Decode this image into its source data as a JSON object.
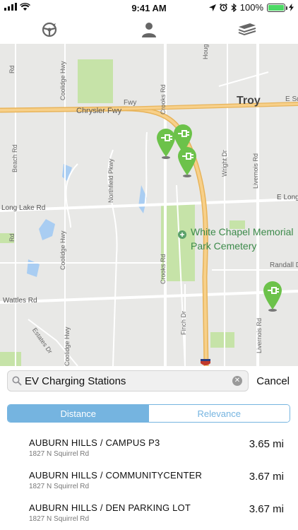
{
  "status_bar": {
    "time": "9:41 AM",
    "battery": "100%"
  },
  "nav": {
    "left_icon": "steering-wheel-icon",
    "center_icon": "person-icon",
    "right_icon": "layers-icon"
  },
  "map": {
    "city_label": "Troy",
    "park_label_line1": "White Chapel Memorial",
    "park_label_line2": "Park Cemetery",
    "roads": {
      "chrysler_fwy": "Chrysler Fwy",
      "long_lake_w": "Long Lake Rd",
      "long_lake_e": "E Long",
      "wattles": "Wattles Rd",
      "e_square": "E Sq",
      "randall": "Randall D",
      "beach": "Beach Rd",
      "beach2": "Beach Rd",
      "coolidge_n": "Coolidge Hwy",
      "coolidge_m": "Coolidge Hwy",
      "coolidge_s": "Coolidge Hwy",
      "northfield": "Northfield Pkwy",
      "crooks_n": "Crooks Rd",
      "crooks_s": "Crooks Rd",
      "wright": "Wright Dr",
      "livernois_n": "Livernois Rd",
      "livernois_s": "Livernois Rd",
      "finch": "Finch Dr",
      "estates": "Estates Dr",
      "hough": "Houg",
      "fwy_lower": "Fwy",
      "fwy_upper": "Fwy",
      "road_w1": "Rd",
      "road_w2": "Rd"
    },
    "pins": [
      "ev-charging-pin",
      "ev-charging-pin",
      "ev-charging-pin",
      "ev-charging-pin"
    ]
  },
  "search": {
    "value": "EV Charging Stations",
    "placeholder": "Search",
    "cancel_label": "Cancel"
  },
  "segments": {
    "distance": "Distance",
    "relevance": "Relevance",
    "active": "distance"
  },
  "results": [
    {
      "title": "AUBURN HILLS / CAMPUS P3",
      "address": "1827 N Squirrel Rd",
      "distance": "3.65 mi"
    },
    {
      "title": "AUBURN HILLS / COMMUNITYCENTER",
      "address": "1827 N Squirrel Rd",
      "distance": "3.67 mi"
    },
    {
      "title": "AUBURN HILLS / DEN PARKING LOT",
      "address": "1827 N Squirrel Rd",
      "distance": "3.67 mi"
    }
  ],
  "colors": {
    "accent": "#75b4e0",
    "pin_green": "#6cc24a",
    "freeway": "#f5c87a",
    "park": "#c6e3a8"
  }
}
